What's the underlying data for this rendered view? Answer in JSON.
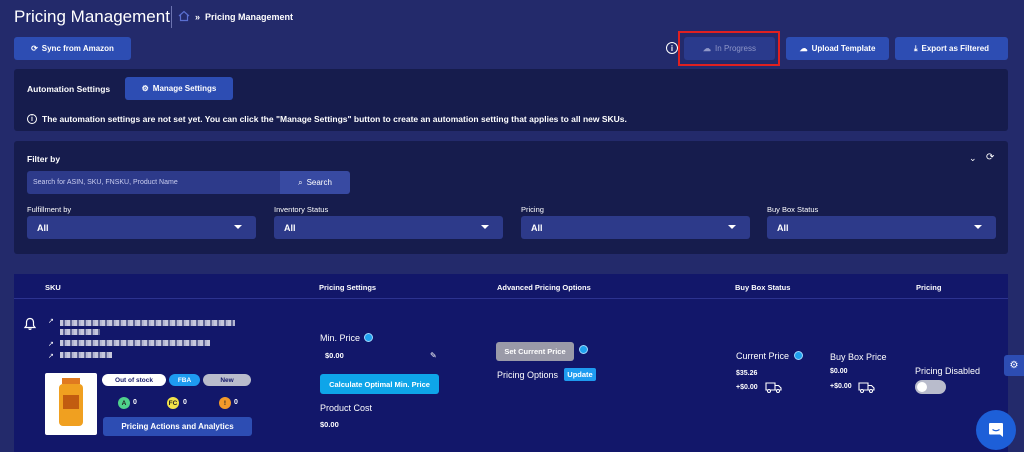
{
  "header": {
    "title": "Pricing Management",
    "breadcrumb_current": "Pricing Management"
  },
  "toolbar": {
    "sync_label": "Sync from Amazon",
    "in_progress_label": "In Progress",
    "upload_label": "Upload Template",
    "export_label": "Export as Filtered"
  },
  "automation": {
    "title": "Automation Settings",
    "manage_label": "Manage Settings",
    "notice": "The automation settings are not set yet. You can click the \"Manage Settings\" button to create an automation setting that applies to all new SKUs."
  },
  "filter": {
    "title": "Filter by",
    "search_placeholder": "Search for ASIN, SKU, FNSKU, Product Name",
    "search_button": "Search",
    "fields": [
      {
        "label": "Fulfillment by",
        "value": "All"
      },
      {
        "label": "Inventory Status",
        "value": "All"
      },
      {
        "label": "Pricing",
        "value": "All"
      },
      {
        "label": "Buy Box Status",
        "value": "All"
      }
    ]
  },
  "table": {
    "columns": [
      "SKU",
      "Pricing Settings",
      "Advanced Pricing Options",
      "Buy Box Status",
      "Pricing"
    ],
    "row": {
      "badges": {
        "stock": "Out of stock",
        "fba": "FBA",
        "condition": "New"
      },
      "counts": [
        {
          "letter": "A",
          "value": "0",
          "color": "#4fd18b"
        },
        {
          "letter": "FC",
          "value": "0",
          "color": "#f2e34a"
        },
        {
          "letter": "!",
          "value": "0",
          "color": "#f39a2a"
        }
      ],
      "actions_label": "Pricing Actions and Analytics",
      "min_price_label": "Min. Price",
      "min_price_value": "$0.00",
      "calc_label": "Calculate Optimal Min. Price",
      "product_cost_label": "Product Cost",
      "product_cost_value": "$0.00",
      "set_current_label": "Set Current Price",
      "pricing_options_label": "Pricing Options",
      "update_label": "Update",
      "current_price_label": "Current Price",
      "current_price_value": "$35.26",
      "current_shipping": "+$0.00",
      "buybox_price_label": "Buy Box Price",
      "buybox_price_value": "$0.00",
      "buybox_shipping": "+$0.00",
      "pricing_status": "Pricing Disabled"
    }
  },
  "colors": {
    "background": "#232a6b",
    "panel": "#161c4d",
    "accent": "#2d4db3",
    "highlight_red": "#e02020",
    "cyan": "#0ea5e9"
  }
}
